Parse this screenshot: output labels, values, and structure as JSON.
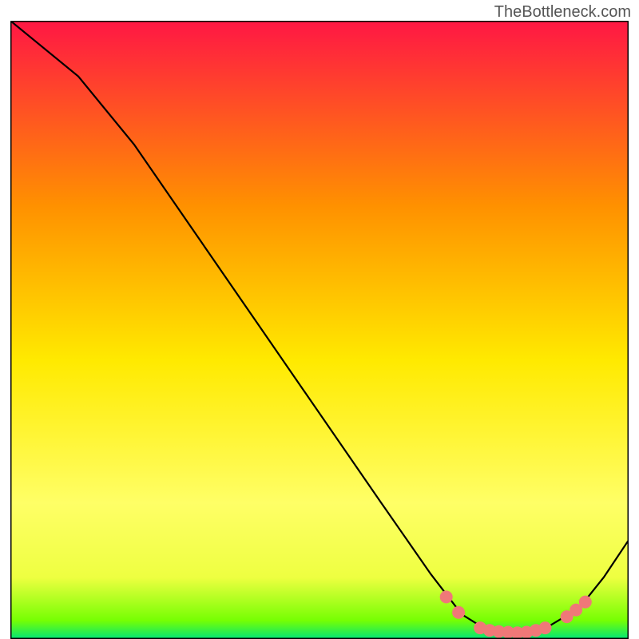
{
  "attribution": "TheBottleneck.com",
  "chart_data": {
    "type": "line",
    "title": "",
    "xlabel": "",
    "ylabel": "",
    "xlim": [
      0,
      100
    ],
    "ylim": [
      0,
      100
    ],
    "gradient_colors": {
      "top": "#ff1744",
      "upper_mid": "#ff9100",
      "mid": "#ffea00",
      "lower_mid": "#eeff41",
      "bottom": "#00e676"
    },
    "curve": [
      {
        "x": 0,
        "y": 100
      },
      {
        "x": 11,
        "y": 91
      },
      {
        "x": 20,
        "y": 80
      },
      {
        "x": 30,
        "y": 65.5
      },
      {
        "x": 40,
        "y": 51
      },
      {
        "x": 50,
        "y": 36.5
      },
      {
        "x": 60,
        "y": 22
      },
      {
        "x": 68,
        "y": 10.5
      },
      {
        "x": 73,
        "y": 4
      },
      {
        "x": 77,
        "y": 1.5
      },
      {
        "x": 82,
        "y": 1
      },
      {
        "x": 87,
        "y": 2
      },
      {
        "x": 92,
        "y": 5
      },
      {
        "x": 96,
        "y": 10
      },
      {
        "x": 100,
        "y": 16
      }
    ],
    "markers": [
      {
        "x": 70.5,
        "y": 6.8
      },
      {
        "x": 72.5,
        "y": 4.3
      },
      {
        "x": 76,
        "y": 1.8
      },
      {
        "x": 77.5,
        "y": 1.4
      },
      {
        "x": 79,
        "y": 1.2
      },
      {
        "x": 80.5,
        "y": 1.1
      },
      {
        "x": 82,
        "y": 1.0
      },
      {
        "x": 83.5,
        "y": 1.1
      },
      {
        "x": 85,
        "y": 1.4
      },
      {
        "x": 86.5,
        "y": 1.8
      },
      {
        "x": 90,
        "y": 3.6
      },
      {
        "x": 91.5,
        "y": 4.7
      },
      {
        "x": 93,
        "y": 6.0
      }
    ],
    "marker_color": "#f07878",
    "border_color": "#000000"
  }
}
